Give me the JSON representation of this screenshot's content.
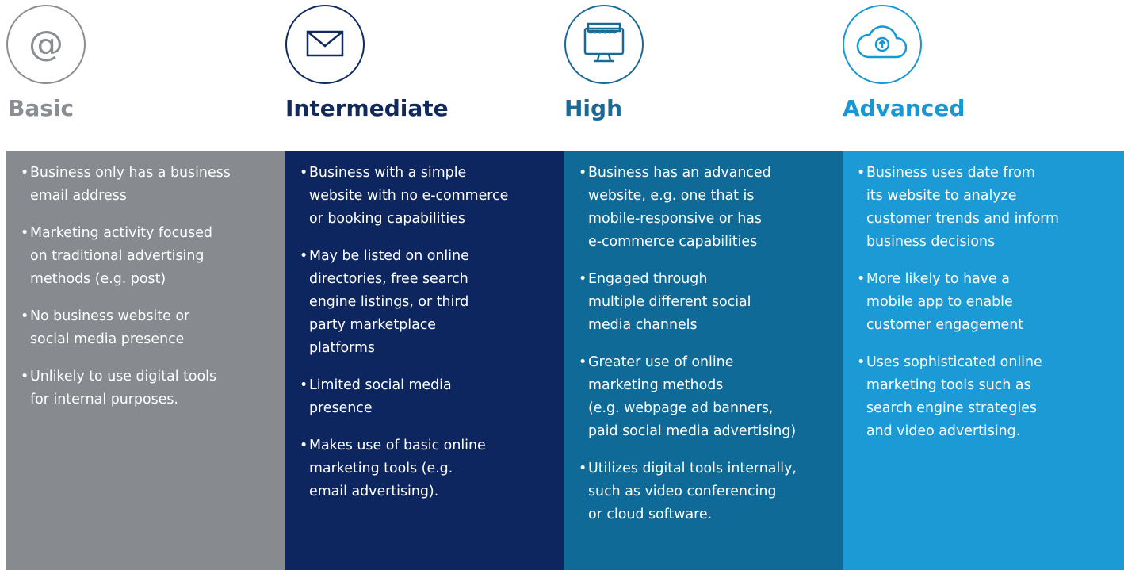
{
  "colors": {
    "basic_title": "#8a8d91",
    "basic_panel": "#878a8e",
    "intermediate_title": "#102a5e",
    "intermediate_panel": "#0d2660",
    "high_title": "#1b6a96",
    "high_panel": "#0f6a98",
    "advanced_title": "#1598d3",
    "advanced_panel": "#1c9ad6",
    "panel_text": "#ffffff"
  },
  "tiers": [
    {
      "title": "Basic",
      "icon": "at-sign-icon",
      "bullets": [
        "Business only has a business\nemail address",
        "Marketing activity focused\non traditional advertising\nmethods (e.g. post)",
        "No business website or\nsocial media presence",
        "Unlikely to use digital tools\nfor internal purposes."
      ]
    },
    {
      "title": "Intermediate",
      "icon": "envelope-icon",
      "bullets": [
        "Business with a simple\nwebsite with no e-commerce\nor booking capabilities",
        "May be listed on online\ndirectories, free search\nengine listings, or third\nparty marketplace\nplatforms",
        "Limited social media\npresence",
        "Makes use of basic online\nmarketing tools (e.g.\nemail advertising)."
      ]
    },
    {
      "title": "High",
      "icon": "storefront-monitor-icon",
      "bullets": [
        "Business has an advanced\nwebsite, e.g. one that is\nmobile-responsive or has\ne-commerce capabilities",
        "Engaged through\nmultiple different social\nmedia channels",
        "Greater use of online\nmarketing methods\n(e.g. webpage ad banners,\npaid social media advertising)",
        "Utilizes digital tools internally,\nsuch as video conferencing\nor cloud software."
      ]
    },
    {
      "title": "Advanced",
      "icon": "cloud-upload-icon",
      "bullets": [
        "Business uses date from\nits website to analyze\ncustomer trends and inform\nbusiness decisions",
        "More likely to have a\nmobile app to enable\ncustomer engagement",
        "Uses sophisticated online\nmarketing tools such as\nsearch engine strategies\nand video advertising."
      ]
    }
  ]
}
